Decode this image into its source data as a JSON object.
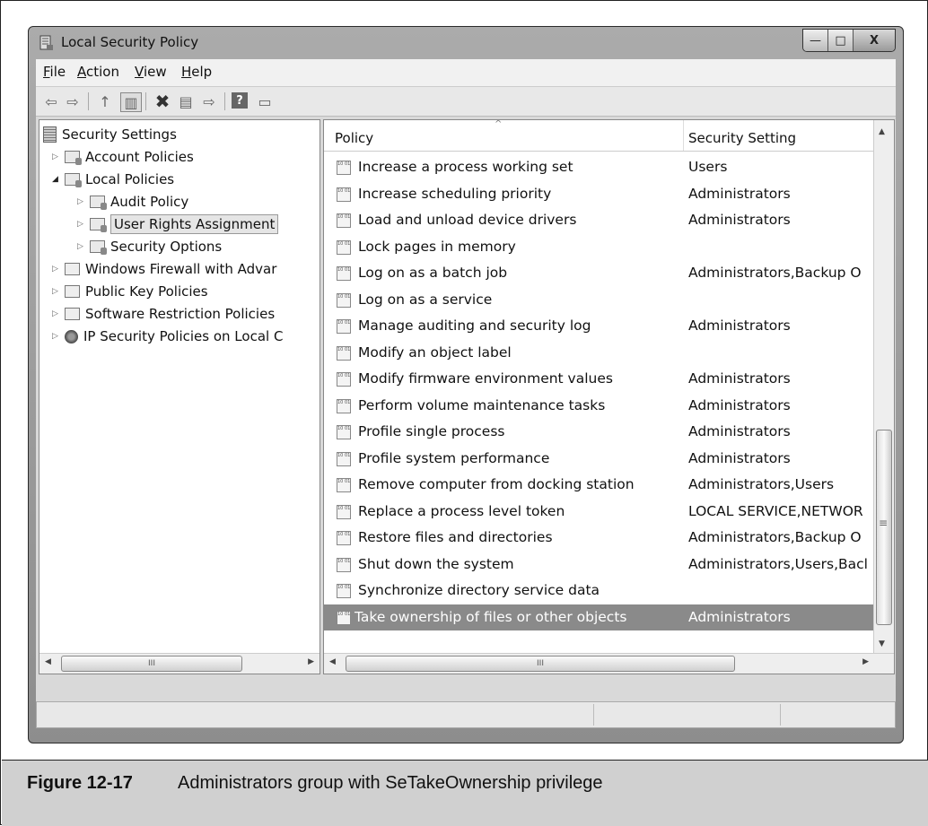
{
  "window": {
    "title": "Local Security Policy",
    "controls": {
      "minimize": "—",
      "maximize": "□",
      "close": "X"
    }
  },
  "menu": {
    "items": [
      {
        "label": "File",
        "accel": "F"
      },
      {
        "label": "Action",
        "accel": "A"
      },
      {
        "label": "View",
        "accel": "V"
      },
      {
        "label": "Help",
        "accel": "H"
      }
    ]
  },
  "toolbar": {
    "back": "⇦",
    "forward": "⇨",
    "up": "↑",
    "show_tree": "▥",
    "delete": "✖",
    "properties": "▤",
    "export": "⇨",
    "help": "?",
    "show_action": "▭"
  },
  "tree": {
    "root": "Security Settings",
    "items": [
      {
        "label": "Account Policies"
      },
      {
        "label": "Local Policies"
      },
      {
        "label": "Audit Policy"
      },
      {
        "label": "User Rights Assignment"
      },
      {
        "label": "Security Options"
      },
      {
        "label": "Windows Firewall with Advar"
      },
      {
        "label": "Public Key Policies"
      },
      {
        "label": "Software Restriction Policies"
      },
      {
        "label": "IP Security Policies on Local C"
      }
    ],
    "scroll_thumb": "III"
  },
  "list": {
    "columns": {
      "policy": "Policy",
      "setting": "Security Setting"
    },
    "rows": [
      {
        "policy": "Increase a process working set",
        "setting": "Users"
      },
      {
        "policy": "Increase scheduling priority",
        "setting": "Administrators"
      },
      {
        "policy": "Load and unload device drivers",
        "setting": "Administrators"
      },
      {
        "policy": "Lock pages in memory",
        "setting": ""
      },
      {
        "policy": "Log on as a batch job",
        "setting": "Administrators,Backup O"
      },
      {
        "policy": "Log on as a service",
        "setting": ""
      },
      {
        "policy": "Manage auditing and security log",
        "setting": "Administrators"
      },
      {
        "policy": "Modify an object label",
        "setting": ""
      },
      {
        "policy": "Modify firmware environment values",
        "setting": "Administrators"
      },
      {
        "policy": "Perform volume maintenance tasks",
        "setting": "Administrators"
      },
      {
        "policy": "Profile single process",
        "setting": "Administrators"
      },
      {
        "policy": "Profile system performance",
        "setting": "Administrators"
      },
      {
        "policy": "Remove computer from docking station",
        "setting": "Administrators,Users"
      },
      {
        "policy": "Replace a process level token",
        "setting": "LOCAL SERVICE,NETWOR"
      },
      {
        "policy": "Restore files and directories",
        "setting": "Administrators,Backup O"
      },
      {
        "policy": "Shut down the system",
        "setting": "Administrators,Users,Bacl"
      },
      {
        "policy": "Synchronize directory service data",
        "setting": ""
      },
      {
        "policy": "Take ownership of files or other objects",
        "setting": "Administrators"
      }
    ],
    "hscroll_thumb": "III",
    "vscroll_grip": "≡"
  },
  "caption": {
    "number": "Figure 12-17",
    "text": "Administrators group with SeTakeOwnership privilege"
  }
}
